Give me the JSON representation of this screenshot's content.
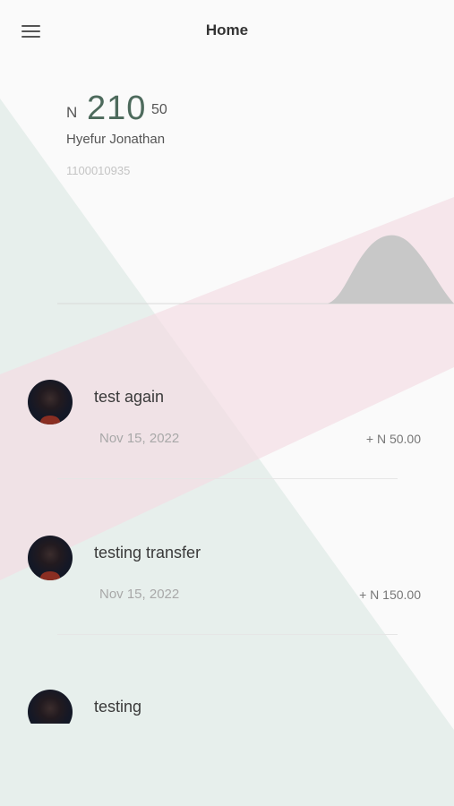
{
  "header": {
    "title": "Home",
    "menu_icon": "hamburger-menu-icon"
  },
  "account": {
    "currency": "N",
    "balance_major": "210",
    "balance_minor": "50",
    "holder_name": "Hyefur Jonathan",
    "account_number": "1100010935"
  },
  "transactions": [
    {
      "title": "test again",
      "date": "Nov 15, 2022",
      "amount": "+ N 50.00"
    },
    {
      "title": "testing transfer",
      "date": "Nov 15, 2022",
      "amount": "+ N 150.00"
    },
    {
      "title": "testing"
    }
  ],
  "colors": {
    "background": "#fafafa",
    "balance_accent": "#4d6a5c",
    "stripe_pink": "#f6e4ea",
    "stripe_green": "#e7efec",
    "chart_fill": "#c8c8c8"
  }
}
